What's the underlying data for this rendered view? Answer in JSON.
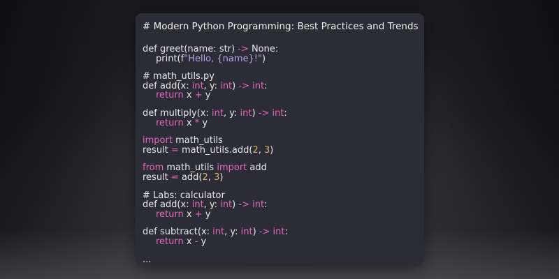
{
  "card": {
    "title": "# Modern Python Programming: Best Practices and Trends",
    "blocks": [
      [
        [
          [
            "def greet(name: str) ",
            "t"
          ],
          [
            "->",
            "op"
          ],
          [
            " None:",
            "t"
          ]
        ],
        [
          [
            "print(f",
            "t",
            1
          ],
          [
            "\"Hello, {name}!\"",
            "str"
          ],
          [
            ")",
            "t"
          ]
        ]
      ],
      [
        [
          [
            "# math_utils.py",
            "cm"
          ]
        ],
        [
          [
            "def add(x: ",
            "t"
          ],
          [
            "int",
            "ty"
          ],
          [
            ", y: ",
            "t"
          ],
          [
            "int",
            "ty"
          ],
          [
            ") ",
            "t"
          ],
          [
            "->",
            "op"
          ],
          [
            " ",
            "t"
          ],
          [
            "int",
            "ty"
          ],
          [
            ":",
            "t"
          ]
        ],
        [
          [
            "return",
            "kw",
            1
          ],
          [
            " x ",
            "t"
          ],
          [
            "+",
            "op"
          ],
          [
            " y",
            "t"
          ]
        ]
      ],
      [
        [
          [
            "def multiply(x: ",
            "t"
          ],
          [
            "int",
            "ty"
          ],
          [
            ", y: ",
            "t"
          ],
          [
            "int",
            "ty"
          ],
          [
            ") ",
            "t"
          ],
          [
            "->",
            "op"
          ],
          [
            " ",
            "t"
          ],
          [
            "int",
            "ty"
          ],
          [
            ":",
            "t"
          ]
        ],
        [
          [
            "return",
            "kw",
            1
          ],
          [
            " x ",
            "t"
          ],
          [
            "*",
            "op"
          ],
          [
            " y",
            "t"
          ]
        ]
      ],
      [
        [
          [
            "import",
            "kw"
          ],
          [
            " math_utils",
            "t"
          ]
        ],
        [
          [
            "result ",
            "t"
          ],
          [
            "=",
            "op"
          ],
          [
            " math_utils.add(",
            "t"
          ],
          [
            "2",
            "num"
          ],
          [
            ", ",
            "t"
          ],
          [
            "3",
            "num"
          ],
          [
            ")",
            "t"
          ]
        ]
      ],
      [
        [
          [
            "from",
            "kw"
          ],
          [
            " math_utils ",
            "t"
          ],
          [
            "import",
            "kw"
          ],
          [
            " add",
            "t"
          ]
        ],
        [
          [
            "result ",
            "t"
          ],
          [
            "=",
            "op"
          ],
          [
            " add(",
            "t"
          ],
          [
            "2",
            "num"
          ],
          [
            ", ",
            "t"
          ],
          [
            "3",
            "num"
          ],
          [
            ")",
            "t"
          ]
        ]
      ],
      [
        [
          [
            "# Labs: calculator",
            "cm"
          ]
        ],
        [
          [
            "def add(x: ",
            "t"
          ],
          [
            "int",
            "ty"
          ],
          [
            ", y: ",
            "t"
          ],
          [
            "int",
            "ty"
          ],
          [
            ") ",
            "t"
          ],
          [
            "->",
            "op"
          ],
          [
            " ",
            "t"
          ],
          [
            "int",
            "ty"
          ],
          [
            ":",
            "t"
          ]
        ],
        [
          [
            "return",
            "kw",
            1
          ],
          [
            " x ",
            "t"
          ],
          [
            "+",
            "op"
          ],
          [
            " y",
            "t"
          ]
        ]
      ],
      [
        [
          [
            "def subtract(x: ",
            "t"
          ],
          [
            "int",
            "ty"
          ],
          [
            ", y: ",
            "t"
          ],
          [
            "int",
            "ty"
          ],
          [
            ") ",
            "t"
          ],
          [
            "->",
            "op"
          ],
          [
            " ",
            "t"
          ],
          [
            "int",
            "ty"
          ],
          [
            ":",
            "t"
          ]
        ],
        [
          [
            "return",
            "kw",
            1
          ],
          [
            " x ",
            "t"
          ],
          [
            "-",
            "op"
          ],
          [
            " y",
            "t"
          ]
        ]
      ],
      [
        [
          [
            "...",
            "t"
          ]
        ]
      ]
    ]
  },
  "colors": {
    "keyword": "#e26ab8",
    "number": "#d7b56a",
    "string": "#b7a3e8",
    "text": "#e8e8ea",
    "card_background": "#2b2c35"
  }
}
